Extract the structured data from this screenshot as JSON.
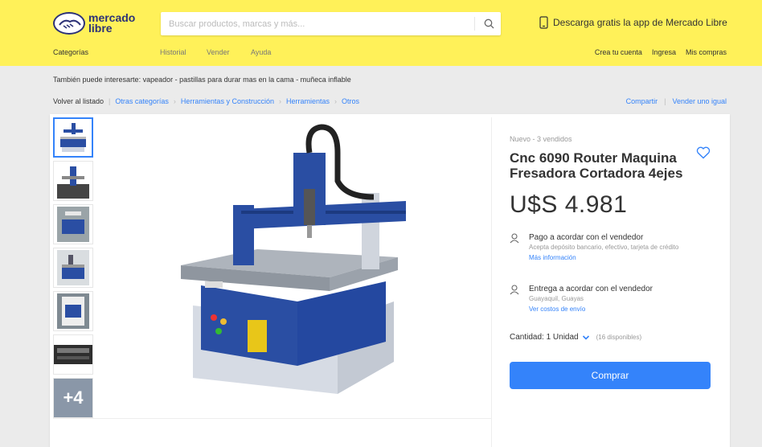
{
  "header": {
    "logo_text_line1": "mercado",
    "logo_text_line2": "libre",
    "search_placeholder": "Buscar productos, marcas y más...",
    "app_promo": "Descarga gratis la app de Mercado Libre",
    "nav": {
      "categories": "Categorías",
      "history": "Historial",
      "sell": "Vender",
      "help": "Ayuda",
      "create_account": "Crea tu cuenta",
      "login": "Ingresa",
      "purchases": "Mis compras"
    }
  },
  "suggestions": {
    "label": "También puede interesarte:",
    "items": "vapeador - pastillas para durar mas en la cama - muñeca inflable"
  },
  "breadcrumb": {
    "back": "Volver al listado",
    "crumbs": [
      "Otras categorías",
      "Herramientas y Construcción",
      "Herramientas",
      "Otros"
    ],
    "share": "Compartir",
    "sell_one": "Vender uno igual"
  },
  "gallery": {
    "more_count": "+4"
  },
  "product": {
    "condition": "Nuevo - 3 vendidos",
    "title": "Cnc 6090 Router Maquina Fresadora Cortadora 4ejes",
    "price": "U$S 4.981",
    "payment_title": "Pago a acordar con el vendedor",
    "payment_sub": "Acepta depósito bancario, efectivo, tarjeta de crédito",
    "payment_link": "Más información",
    "delivery_title": "Entrega a acordar con el vendedor",
    "delivery_sub": "Guayaquil, Guayas",
    "delivery_link": "Ver costos de envío",
    "quantity": "Cantidad: 1 Unidad",
    "available": "(16 disponibles)",
    "buy_label": "Comprar"
  },
  "colors": {
    "header_yellow": "#fff159",
    "accent_blue": "#3483fa",
    "machine_blue": "#2a4ea3"
  }
}
